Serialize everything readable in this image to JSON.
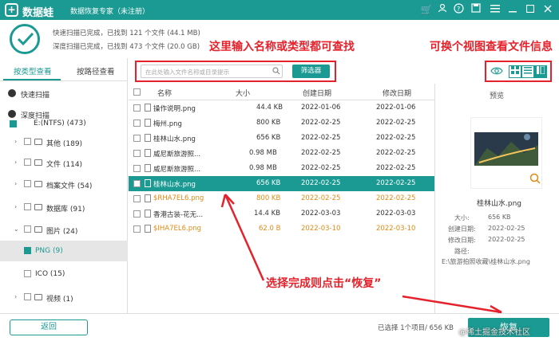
{
  "app": {
    "brand": "数据蛙",
    "subtitle": "数据恢复专家（未注册）"
  },
  "scan": {
    "quick": "快速扫描已完成，已找到 121 个文件 (44.1 MB)",
    "deep": "深度扫描已完成，已找到 473 个文件 (20.0 GB)"
  },
  "annotations": {
    "search_hint": "这里输入名称或类型都可查找",
    "view_hint": "可换个视图查看文件信息",
    "recover_hint": "选择完成则点击“恢复”"
  },
  "tabs": {
    "by_type": "按类型查看",
    "by_path": "按路径查看"
  },
  "tree": [
    {
      "label": "快速扫描",
      "level": 0
    },
    {
      "label": "深度扫描",
      "level": 0
    },
    {
      "label": "E:(NTFS) (473)",
      "level": 1
    },
    {
      "label": "其他 (189)",
      "level": 2
    },
    {
      "label": "文件 (114)",
      "level": 2
    },
    {
      "label": "档案文件 (54)",
      "level": 2
    },
    {
      "label": "数据库 (91)",
      "level": 2
    },
    {
      "label": "图片 (24)",
      "level": 2
    },
    {
      "label": "PNG (9)",
      "level": 3
    },
    {
      "label": "ICO (15)",
      "level": 3
    },
    {
      "label": "视频 (1)",
      "level": 2
    }
  ],
  "search": {
    "placeholder": "在此处输入文件名称或目录提示"
  },
  "filter_label": "筛选器",
  "columns": {
    "name": "名称",
    "size": "大小",
    "created": "创建日期",
    "modified": "修改日期"
  },
  "rows": [
    {
      "name": "操作说明.png",
      "size": "44.4 KB",
      "created": "2022-01-06",
      "modified": "2022-01-06"
    },
    {
      "name": "梅州.png",
      "size": "800 KB",
      "created": "2022-02-25",
      "modified": "2022-02-25"
    },
    {
      "name": "桂林山水.png",
      "size": "656 KB",
      "created": "2022-02-25",
      "modified": "2022-02-25"
    },
    {
      "name": "威尼斯旅游照...",
      "size": "0.98 MB",
      "created": "2022-02-25",
      "modified": "2022-02-25"
    },
    {
      "name": "威尼斯旅游照...",
      "size": "0.98 MB",
      "created": "2022-02-25",
      "modified": "2022-02-25"
    },
    {
      "name": "桂林山水.png",
      "size": "656 KB",
      "created": "2022-02-25",
      "modified": "2022-02-25"
    },
    {
      "name": "$RHA7EL6.png",
      "size": "800 KB",
      "created": "2022-02-25",
      "modified": "2022-02-25"
    },
    {
      "name": "香港古装-花无...",
      "size": "14.4 KB",
      "created": "2022-03-03",
      "modified": "2022-03-03"
    },
    {
      "name": "$IHA7EL6.png",
      "size": "62.0 B",
      "created": "2022-03-10",
      "modified": "2022-03-10"
    }
  ],
  "preview": {
    "title": "预览",
    "filename": "桂林山水.png",
    "size_label": "大小:",
    "size": "656 KB",
    "created_label": "创建日期:",
    "created": "2022-02-25",
    "modified_label": "修改日期:",
    "modified": "2022-02-25",
    "path_label": "路径:",
    "path": "E:\\旅游拍照收藏\\桂林山水.png"
  },
  "bottom": {
    "back": "返回",
    "status": "已选择 1个项目/ 656 KB",
    "recover": "恢复",
    "watermark": "@稀土掘金技术社区"
  },
  "colors": {
    "accent": "#1a9a92",
    "annotation": "#e5222b",
    "orange_text": "#e08a15"
  }
}
